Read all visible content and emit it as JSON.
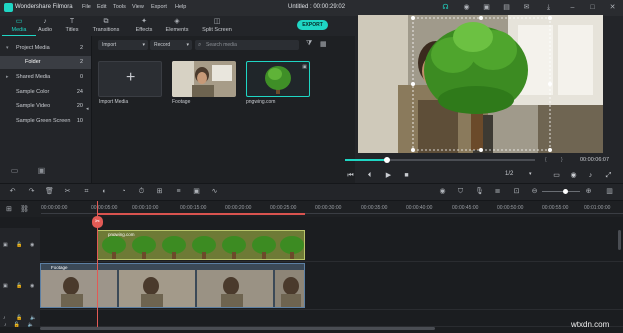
{
  "app": {
    "name": "Wondershare Filmora",
    "menus": [
      "File",
      "Edit",
      "Tools",
      "View",
      "Export",
      "Help"
    ],
    "doc_title": "Untitled : 00:00:29:02",
    "export_label": "EXPORT"
  },
  "tabs": [
    {
      "label": "Media",
      "icon": "folder-icon",
      "active": true
    },
    {
      "label": "Audio",
      "icon": "music-note-icon"
    },
    {
      "label": "Titles",
      "icon": "text-icon"
    },
    {
      "label": "Transitions",
      "icon": "transitions-icon"
    },
    {
      "label": "Effects",
      "icon": "effects-icon"
    },
    {
      "label": "Elements",
      "icon": "elements-icon"
    },
    {
      "label": "Split Screen",
      "icon": "split-screen-icon"
    }
  ],
  "sidebar": {
    "items": [
      {
        "label": "Project Media",
        "count": "2",
        "expanded": true
      },
      {
        "label": "Folder",
        "count": "2",
        "selected": true
      },
      {
        "label": "Shared Media",
        "count": "0"
      },
      {
        "label": "Sample Color",
        "count": "24"
      },
      {
        "label": "Sample Video",
        "count": "20"
      },
      {
        "label": "Sample Green Screen",
        "count": "10"
      }
    ]
  },
  "media": {
    "import_select": "Import",
    "record_select": "Record",
    "search_placeholder": "Search media",
    "items": [
      {
        "label": "Import Media"
      },
      {
        "label": "Footage"
      },
      {
        "label": "pngwing.com"
      }
    ]
  },
  "player": {
    "time": "00:00:06:07",
    "quality": "1/2",
    "progress": 0.22
  },
  "timeline": {
    "ruler": [
      "00:00:00:00",
      "00:00:05:00",
      "00:00:10:00",
      "00:00:15:00",
      "00:00:20:00",
      "00:00:25:00",
      "00:00:30:00",
      "00:00:35:00",
      "00:00:40:00",
      "00:00:45:00",
      "00:00:50:00",
      "00:00:55:00",
      "00:01:00:00"
    ],
    "clips": [
      {
        "label": "pngwing.com"
      },
      {
        "label": "Footage"
      }
    ]
  },
  "watermark": "wtxdn.com",
  "colors": {
    "accent": "#1fd6c4",
    "playhead": "#e25a55"
  }
}
